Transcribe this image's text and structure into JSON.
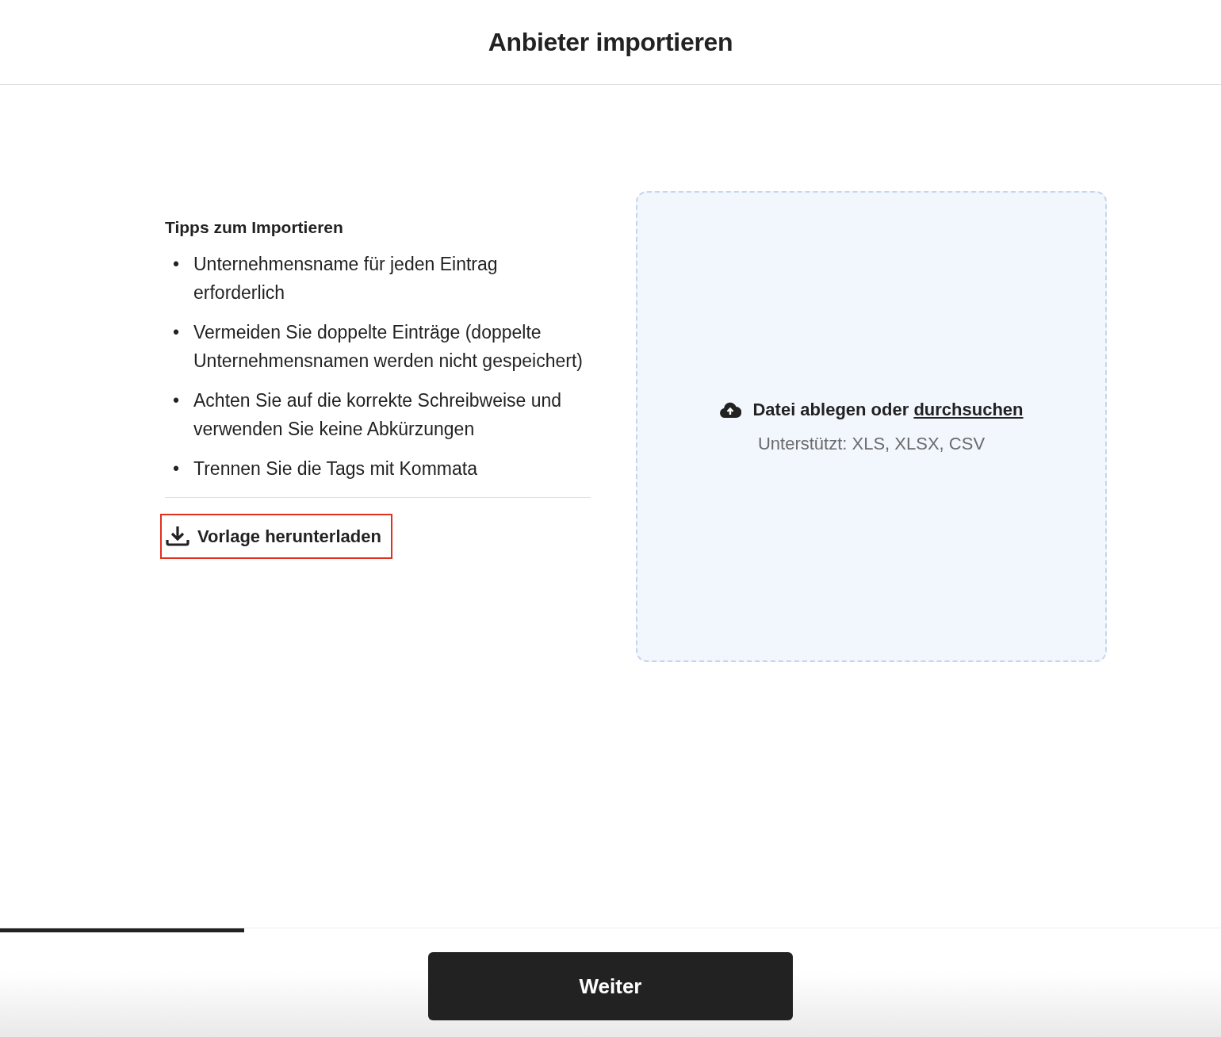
{
  "header": {
    "title": "Anbieter importieren"
  },
  "tips": {
    "title": "Tipps zum Importieren",
    "items": [
      {
        "bullet": "•",
        "text": "Unternehmensname für jeden Eintrag erforderlich"
      },
      {
        "bullet": "•",
        "text": "Vermeiden Sie doppelte Einträge (doppelte Unternehmensnamen werden nicht gespeichert)"
      },
      {
        "bullet": "•",
        "text": "Achten Sie auf die korrekte Schreibweise und verwenden Sie keine Abkürzungen"
      },
      {
        "bullet": "•",
        "text": "Trennen Sie die Tags mit Kommata"
      }
    ]
  },
  "download_link": {
    "label": "Vorlage herunterladen",
    "highlighted": true
  },
  "dropzone": {
    "text": "Datei ablegen oder",
    "link": "durchsuchen",
    "hint": "Unterstützt: XLS, XLSX, CSV"
  },
  "progress": {
    "level": 0.2
  },
  "footer": {
    "button": "Weiter"
  }
}
